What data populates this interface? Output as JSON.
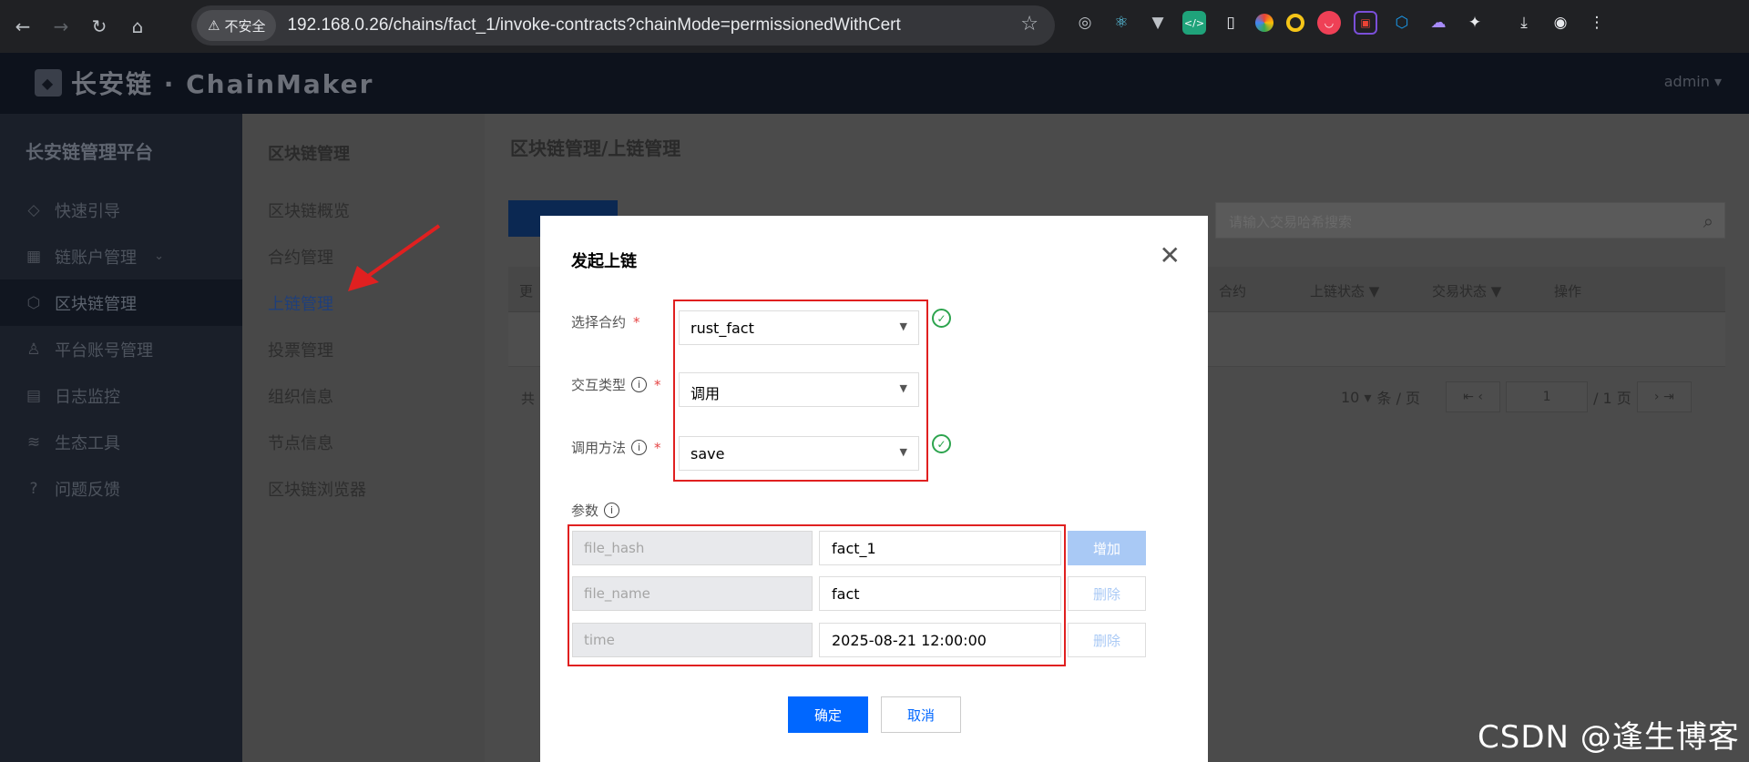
{
  "browser": {
    "back_icon": "←",
    "forward_icon": "→",
    "reload_icon": "↻",
    "home_icon": "⌂",
    "security_label": "不安全",
    "warning_icon": "⚠",
    "url": "192.168.0.26/chains/fact_1/invoke-contracts?chainMode=permissionedWithCert",
    "bookmark_icon": "☆",
    "download_icon": "⤓",
    "profile_icon": "◉",
    "menu_icon": "⋮"
  },
  "app": {
    "logo_text": "长安链 · ChainMaker",
    "user": "admin"
  },
  "sidebar": {
    "title": "长安链管理平台",
    "items": [
      {
        "label": "快速引导",
        "icon": "◇"
      },
      {
        "label": "链账户管理",
        "icon": "▦"
      },
      {
        "label": "区块链管理",
        "icon": "⬡"
      },
      {
        "label": "平台账号管理",
        "icon": "♙"
      },
      {
        "label": "日志监控",
        "icon": "▤"
      },
      {
        "label": "生态工具",
        "icon": "≋"
      },
      {
        "label": "问题反馈",
        "icon": "?"
      }
    ]
  },
  "subnav": {
    "title": "区块链管理",
    "items": [
      "区块链概览",
      "合约管理",
      "上链管理",
      "投票管理",
      "组织信息",
      "节点信息",
      "区块链浏览器"
    ]
  },
  "main": {
    "title": "区块链管理/上链管理",
    "search_placeholder": "请输入交易哈希搜索",
    "columns": {
      "col1": "更",
      "contract": "合约",
      "chain_status": "上链状态",
      "tx_status": "交易状态",
      "action": "操作"
    },
    "total_prefix": "共",
    "page_size": "10",
    "page_size_unit": "条 / 页",
    "page": "1",
    "page_total": "/ 1 页"
  },
  "modal": {
    "title": "发起上链",
    "close_icon": "✕",
    "contract_label": "选择合约",
    "contract_value": "rust_fact",
    "type_label": "交互类型",
    "type_value": "调用",
    "method_label": "调用方法",
    "method_value": "save",
    "params_label": "参数",
    "params": [
      {
        "key": "file_hash",
        "value": "fact_1",
        "action": "增加"
      },
      {
        "key": "file_name",
        "value": "fact",
        "action": "删除"
      },
      {
        "key": "time",
        "value": "2025-08-21 12:00:00",
        "action": "删除"
      }
    ],
    "confirm": "确定",
    "cancel": "取消"
  },
  "watermark": "CSDN @逢生博客",
  "colors": {
    "primary": "#0067ff",
    "annotation_red": "#e02020",
    "success": "#2da44e"
  }
}
